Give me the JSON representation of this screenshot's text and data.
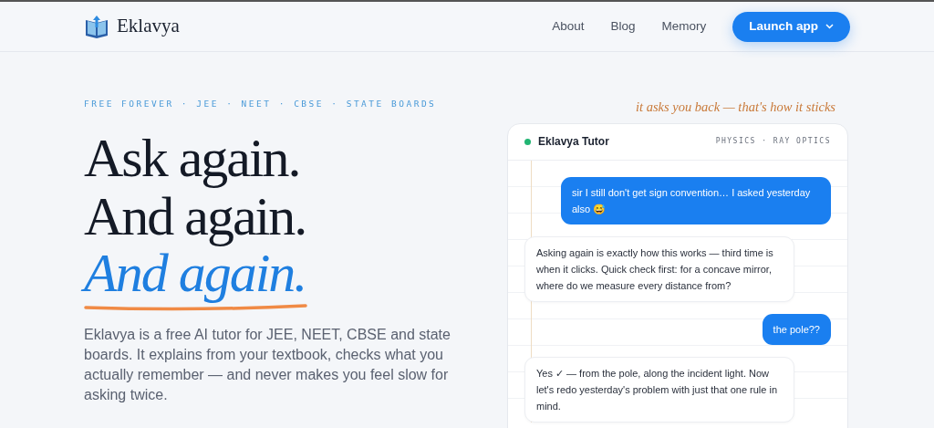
{
  "brand": {
    "name": "Eklavya"
  },
  "nav": {
    "links": [
      {
        "label": "About"
      },
      {
        "label": "Blog"
      },
      {
        "label": "Memory"
      }
    ],
    "cta": "Launch app"
  },
  "hero": {
    "eyebrow": "FREE FOREVER · JEE · NEET · CBSE · STATE BOARDS",
    "headline": [
      {
        "text": "Ask again.",
        "kind": "plain"
      },
      {
        "text": "And again.",
        "kind": "plain"
      },
      {
        "text": "And again.",
        "kind": "accent"
      }
    ],
    "lead": "Eklavya is a free AI tutor for JEE, NEET, CBSE and state boards. It explains from your textbook, checks what you actually remember — and never makes you feel slow for asking twice."
  },
  "chat": {
    "annotation": "it asks you back — that's how it sticks",
    "title": "Eklavya Tutor",
    "online": true,
    "topic": "PHYSICS · RAY OPTICS",
    "messages": [
      {
        "kind": "user",
        "text": "sir I still don't get sign convention… I asked yesterday also 😅"
      },
      {
        "kind": "tutor",
        "text": "Asking again is exactly how this works — third time is when it clicks. Quick check first: for a concave mirror, where do we measure every distance from?"
      },
      {
        "kind": "user",
        "text": "the pole??"
      },
      {
        "kind": "tutor",
        "text": "Yes ✓ — from the pole, along the incident light. Now let's redo yesterday's problem with just that one rule in mind."
      }
    ]
  }
}
